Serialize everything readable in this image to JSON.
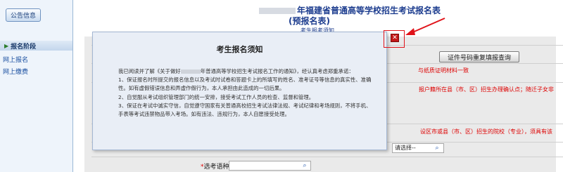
{
  "sidebar": {
    "notice_button": "公告信息",
    "stage_title": "报名阶段",
    "links": [
      "网上报名",
      "网上缴费"
    ]
  },
  "header": {
    "title_line1": "年福建省普通高等学校招生考试报名表",
    "title_line2": "(预报名表)",
    "subtitle": "考生报考须知"
  },
  "form": {
    "check_button": "证件号码重复填报查询",
    "note_red_1": "与纸质证明材料一致",
    "note_red_2": "报户籍所在县（市、区）招生办理确认点；随迁子女非",
    "note_red_3": "设区市或县（市、区）招生的院校（专业），须具有该",
    "note_red_4": "",
    "select_value": "请选择--",
    "language_label": "选考语种",
    "language_required_mark": "*"
  },
  "modal": {
    "title": "考生报名须知",
    "intro_prefix": "我已阅读并了解《关于做好",
    "intro_suffix": "年普通高等学校招生考试报名工作的通知》，经认真考虑郑重承诺：",
    "items": [
      "1、保证报名时所提交的报名信息以及考试时试卷和答题卡上的所填写的姓名、准考证号等信息的真实性、准确性。如有虚假错误信息和弄虚作假行为，本人承担由此造成的一切后果。",
      "2、自觉服从考试组织管理部门的统一安排，接受考试工作人员的检查、监督和管理。",
      "3、保证在考试中诚实守信，自觉遵守国家有关普通高校招生考试法律法规、考试纪律和考场规则，不将手机、手表等考试违禁物品带入考场。如有违法、违规行为，本人自愿接受处理。"
    ]
  },
  "colors": {
    "accent_red": "#e0131a",
    "title_blue": "#1d3d8f",
    "modal_bg": "#e9eef6"
  },
  "icons": {
    "close": "close-icon",
    "search": "search-icon",
    "pointer_arrow": "arrow-annotation"
  }
}
